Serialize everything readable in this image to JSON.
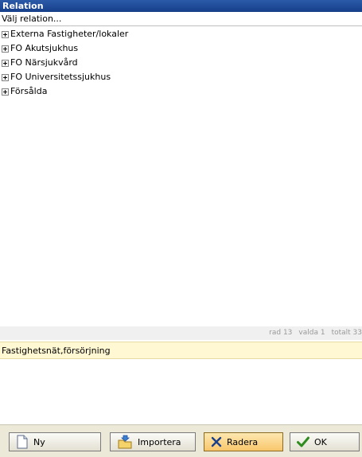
{
  "window": {
    "title": "Relation"
  },
  "selector": {
    "label": "Välj relation..."
  },
  "tree": {
    "items": [
      {
        "label": "Externa Fastigheter/lokaler"
      },
      {
        "label": "FO Akutsjukhus"
      },
      {
        "label": "FO Närsjukvård"
      },
      {
        "label": "FO Universitetssjukhus"
      },
      {
        "label": "Försålda"
      }
    ]
  },
  "status": {
    "rows": "rad 13",
    "selected": "valda 1",
    "total": "totalt 33"
  },
  "detail": {
    "title": "Fastighetsnät,försörjning"
  },
  "buttons": {
    "new_label": "Ny",
    "import_label": "Importera",
    "delete_label": "Radera",
    "ok_label": "OK"
  },
  "colors": {
    "title_bar": "#1f4f9e",
    "detail_highlight": "#fff8d2",
    "ok_check": "#2e8b1e",
    "delete_x": "#1a3f8a"
  }
}
